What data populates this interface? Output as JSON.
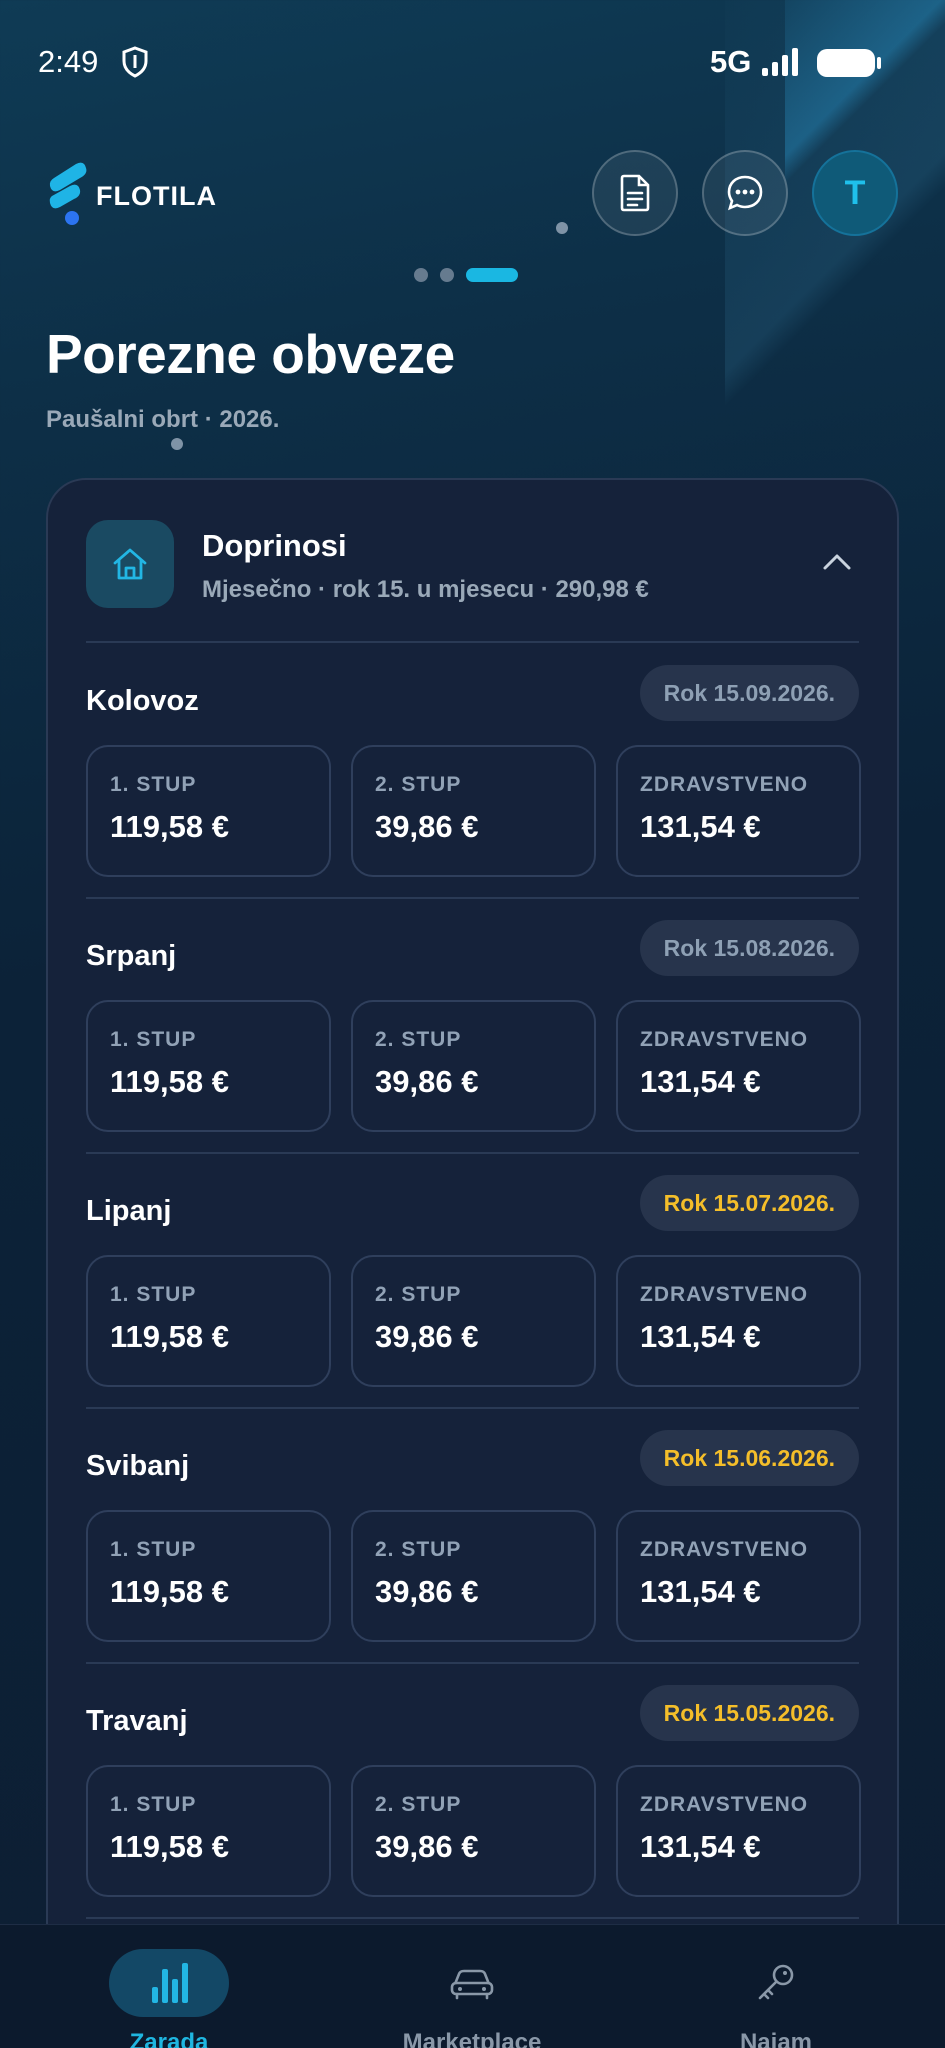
{
  "status_bar": {
    "time": "2:49",
    "network": "5G"
  },
  "header": {
    "logo_text": "FLOTILA",
    "avatar_letter": "T"
  },
  "pager": {
    "count": 3,
    "active_index": 2
  },
  "page": {
    "title": "Porezne obveze",
    "subtitle": "Paušalni obrt · 2026."
  },
  "section": {
    "title": "Doprinosi",
    "subtitle": "Mjesečno · rok 15. u mjesecu · 290,98 €",
    "icon": "home-icon",
    "expanded": true
  },
  "months": [
    {
      "name": "Kolovoz",
      "deadline": "Rok 15.09.2026.",
      "deadline_status": "neutral",
      "items": [
        {
          "label": "1. STUP",
          "value": "119,58 €"
        },
        {
          "label": "2. STUP",
          "value": "39,86 €"
        },
        {
          "label": "ZDRAVSTVENO",
          "value": "131,54 €"
        }
      ]
    },
    {
      "name": "Srpanj",
      "deadline": "Rok 15.08.2026.",
      "deadline_status": "neutral",
      "items": [
        {
          "label": "1. STUP",
          "value": "119,58 €"
        },
        {
          "label": "2. STUP",
          "value": "39,86 €"
        },
        {
          "label": "ZDRAVSTVENO",
          "value": "131,54 €"
        }
      ]
    },
    {
      "name": "Lipanj",
      "deadline": "Rok 15.07.2026.",
      "deadline_status": "warning",
      "items": [
        {
          "label": "1. STUP",
          "value": "119,58 €"
        },
        {
          "label": "2. STUP",
          "value": "39,86 €"
        },
        {
          "label": "ZDRAVSTVENO",
          "value": "131,54 €"
        }
      ]
    },
    {
      "name": "Svibanj",
      "deadline": "Rok 15.06.2026.",
      "deadline_status": "warning",
      "items": [
        {
          "label": "1. STUP",
          "value": "119,58 €"
        },
        {
          "label": "2. STUP",
          "value": "39,86 €"
        },
        {
          "label": "ZDRAVSTVENO",
          "value": "131,54 €"
        }
      ]
    },
    {
      "name": "Travanj",
      "deadline": "Rok 15.05.2026.",
      "deadline_status": "warning",
      "items": [
        {
          "label": "1. STUP",
          "value": "119,58 €"
        },
        {
          "label": "2. STUP",
          "value": "39,86 €"
        },
        {
          "label": "ZDRAVSTVENO",
          "value": "131,54 €"
        }
      ]
    }
  ],
  "bottom_nav": [
    {
      "label": "Zarada",
      "icon": "bar-chart-icon",
      "active": true
    },
    {
      "label": "Marketplace",
      "icon": "car-icon",
      "active": false
    },
    {
      "label": "Najam",
      "icon": "key-icon",
      "active": false
    }
  ],
  "colors": {
    "accent": "#1ab7e2",
    "warning": "#f4be2a",
    "card_bg": "#15223a"
  }
}
